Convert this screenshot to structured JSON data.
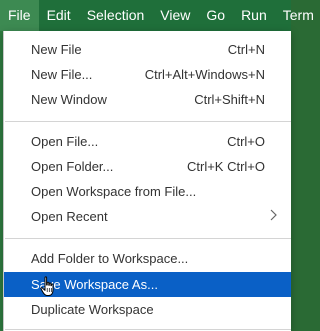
{
  "menubar": {
    "items": [
      "File",
      "Edit",
      "Selection",
      "View",
      "Go",
      "Run",
      "Term"
    ],
    "active_index": 0
  },
  "file_menu": {
    "items": [
      {
        "label": "New File",
        "shortcut": "Ctrl+N"
      },
      {
        "label": "New File...",
        "shortcut": "Ctrl+Alt+Windows+N"
      },
      {
        "label": "New Window",
        "shortcut": "Ctrl+Shift+N"
      },
      {
        "label": "Open File...",
        "shortcut": "Ctrl+O"
      },
      {
        "label": "Open Folder...",
        "shortcut": "Ctrl+K Ctrl+O"
      },
      {
        "label": "Open Workspace from File...",
        "shortcut": ""
      },
      {
        "label": "Open Recent",
        "shortcut": ""
      },
      {
        "label": "Add Folder to Workspace...",
        "shortcut": ""
      },
      {
        "label": "Save Workspace As...",
        "shortcut": ""
      },
      {
        "label": "Duplicate Workspace",
        "shortcut": ""
      }
    ],
    "highlighted_index": 8,
    "submenu_indicator": "chevron-right-icon"
  },
  "colors": {
    "menubar_bg": "#1f6f3a",
    "highlight": "#0a60c6",
    "menu_bg": "#ffffff",
    "text": "#333333"
  },
  "cursor": "hand-pointer-icon"
}
